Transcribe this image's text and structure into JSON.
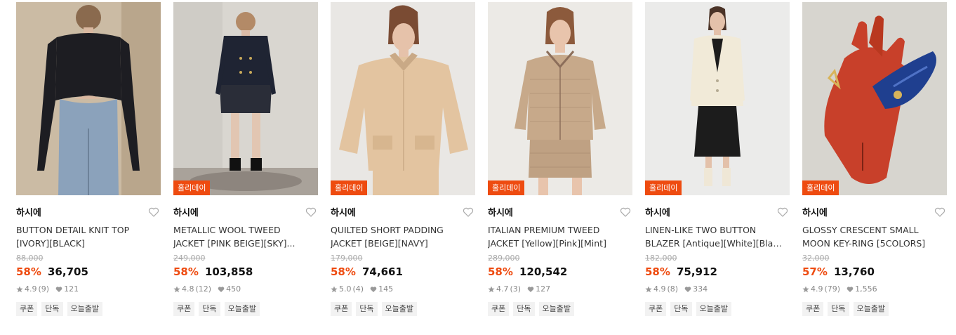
{
  "badge_label": "홀리데이",
  "products": [
    {
      "brand": "하시에",
      "name_line1": "BUTTON DETAIL KNIT TOP",
      "name_line2": "[IVORY][BLACK]",
      "original_price": "88,000",
      "discount": "58%",
      "price": "36,705",
      "rating": "4.9",
      "reviews": "(9)",
      "likes": "121",
      "has_badge": false,
      "tags": [
        "쿠폰",
        "단독",
        "오늘출발"
      ],
      "image_icon": "knit-top-photo",
      "image_colors": {
        "bg": "#c5b49d",
        "garment": "#1d1d22",
        "secondary": "#8ba2bb"
      }
    },
    {
      "brand": "하시에",
      "name_line1": "METALLIC WOOL TWEED",
      "name_line2": "JACKET [PINK BEIGE][SKY]...",
      "original_price": "249,000",
      "discount": "58%",
      "price": "103,858",
      "rating": "4.8",
      "reviews": "(12)",
      "likes": "450",
      "has_badge": true,
      "tags": [
        "쿠폰",
        "단독",
        "오늘출발"
      ],
      "image_icon": "tweed-jacket-photo",
      "image_colors": {
        "bg": "#d9d6d0",
        "garment": "#1f2433",
        "secondary": "#2a2d38"
      }
    },
    {
      "brand": "하시에",
      "name_line1": "QUILTED SHORT PADDING",
      "name_line2": "JACKET [BEIGE][NAVY]",
      "original_price": "179,000",
      "discount": "58%",
      "price": "74,661",
      "rating": "5.0",
      "reviews": "(4)",
      "likes": "145",
      "has_badge": true,
      "tags": [
        "쿠폰",
        "단독",
        "오늘출발"
      ],
      "image_icon": "padding-jacket-photo",
      "image_colors": {
        "bg": "#e9e7e4",
        "garment": "#e3c4a0",
        "secondary": "#c9a986"
      }
    },
    {
      "brand": "하시에",
      "name_line1": "ITALIAN PREMIUM TWEED",
      "name_line2": "JACKET [Yellow][Pink][Mint]",
      "original_price": "289,000",
      "discount": "58%",
      "price": "120,542",
      "rating": "4.7",
      "reviews": "(3)",
      "likes": "127",
      "has_badge": true,
      "tags": [
        "쿠폰",
        "단독",
        "오늘출발"
      ],
      "image_icon": "tweed-set-photo",
      "image_colors": {
        "bg": "#eceae6",
        "garment": "#c7a98a",
        "secondary": "#8c6e5a"
      }
    },
    {
      "brand": "하시에",
      "name_line1": "LINEN-LIKE TWO BUTTON",
      "name_line2": "BLAZER [Antique][White][Black]",
      "original_price": "182,000",
      "discount": "58%",
      "price": "75,912",
      "rating": "4.9",
      "reviews": "(8)",
      "likes": "334",
      "has_badge": true,
      "tags": [
        "쿠폰",
        "단독",
        "오늘출발"
      ],
      "image_icon": "blazer-photo",
      "image_colors": {
        "bg": "#ebebea",
        "garment": "#f1ead8",
        "secondary": "#1c1c1c"
      }
    },
    {
      "brand": "하시에",
      "name_line1": "GLOSSY CRESCENT SMALL",
      "name_line2": "MOON KEY-RING [5COLORS]",
      "original_price": "32,000",
      "discount": "57%",
      "price": "13,760",
      "rating": "4.9",
      "reviews": "(79)",
      "likes": "1,556",
      "has_badge": true,
      "tags": [
        "쿠폰",
        "단독",
        "오늘출발"
      ],
      "image_icon": "glove-keyring-photo",
      "image_colors": {
        "bg": "#d4d2cc",
        "garment": "#c8402a",
        "secondary": "#1f3f8f"
      }
    }
  ]
}
